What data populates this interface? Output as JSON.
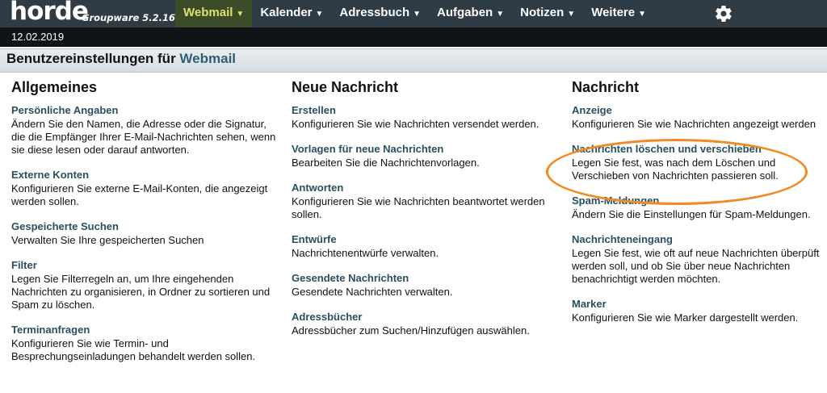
{
  "topbar": {
    "logo_text": "horde",
    "version": "Groupware 5.2.16",
    "nav": [
      {
        "label": "Webmail"
      },
      {
        "label": "Kalender"
      },
      {
        "label": "Adressbuch"
      },
      {
        "label": "Aufgaben"
      },
      {
        "label": "Notizen"
      },
      {
        "label": "Weitere"
      }
    ],
    "dropdown_arrow": "▼",
    "settings_icon": "gear-icon"
  },
  "date": "12.02.2019",
  "page_title": {
    "prefix": "Benutzereinstellungen für",
    "app": "Webmail"
  },
  "columns": [
    {
      "heading": "Allgemeines",
      "entries": [
        {
          "title": "Persönliche Angaben",
          "desc": "Ändern Sie den Namen, die Adresse oder die Signatur, die die Empfänger Ihrer E-Mail-Nachrichten sehen, wenn sie diese lesen oder darauf antworten."
        },
        {
          "title": "Externe Konten",
          "desc": "Konfigurieren Sie externe E-Mail-Konten, die angezeigt werden sollen."
        },
        {
          "title": "Gespeicherte Suchen",
          "desc": "Verwalten Sie Ihre gespeicherten Suchen"
        },
        {
          "title": "Filter",
          "desc": "Legen Sie Filterregeln an, um Ihre eingehenden Nachrichten zu organisieren, in Ordner zu sortieren und Spam zu löschen."
        },
        {
          "title": "Terminanfragen",
          "desc": "Konfigurieren Sie wie Termin- und Besprechungseinladungen behandelt werden sollen."
        }
      ]
    },
    {
      "heading": "Neue Nachricht",
      "entries": [
        {
          "title": "Erstellen",
          "desc": "Konfigurieren Sie wie Nachrichten versendet werden."
        },
        {
          "title": "Vorlagen für neue Nachrichten",
          "desc": "Bearbeiten Sie die Nachrichtenvorlagen."
        },
        {
          "title": "Antworten",
          "desc": "Konfigurieren Sie wie Nachrichten beantwortet werden sollen."
        },
        {
          "title": "Entwürfe",
          "desc": "Nachrichtenentwürfe verwalten."
        },
        {
          "title": "Gesendete Nachrichten",
          "desc": "Gesendete Nachrichten verwalten."
        },
        {
          "title": "Adressbücher",
          "desc": "Adressbücher zum Suchen/Hinzufügen auswählen."
        }
      ]
    },
    {
      "heading": "Nachricht",
      "entries": [
        {
          "title": "Anzeige",
          "desc": "Konfigurieren Sie wie Nachrichten angezeigt werden"
        },
        {
          "title": "Nachrichten löschen und verschieben",
          "desc": "Legen Sie fest, was nach dem Löschen und Verschieben von Nachrichten passieren soll."
        },
        {
          "title": "Spam-Meldungen",
          "desc": "Ändern Sie die Einstellungen für Spam-Meldungen."
        },
        {
          "title": "Nachrichteneingang",
          "desc": "Legen Sie fest, wie oft auf neue Nachrichten überpüft werden soll, und ob Sie über neue Nachrichten benachrichtigt werden möchten."
        },
        {
          "title": "Marker",
          "desc": "Konfigurieren Sie wie Marker dargestellt werden."
        }
      ]
    }
  ],
  "colors": {
    "topbar": "#2f3b45",
    "active_nav_bg": "#3d4c28",
    "active_nav_text": "#d9e26b",
    "link": "#2a4f5e",
    "highlight": "#f08a24"
  }
}
